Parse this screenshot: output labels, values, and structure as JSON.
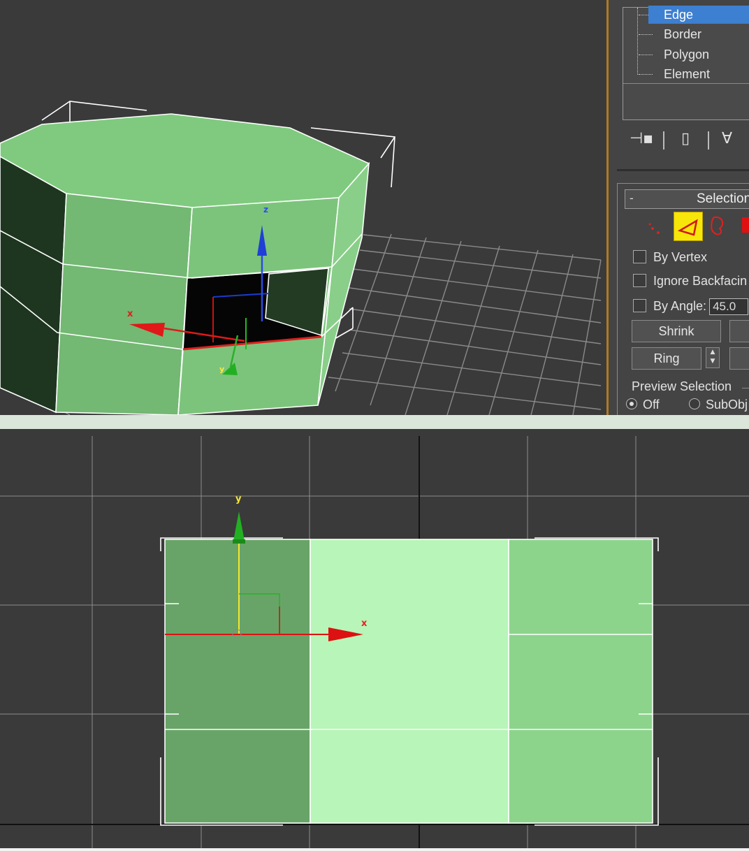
{
  "viewport_perspective": {
    "gizmo_labels": {
      "x": "x",
      "y": "y",
      "z": "z"
    }
  },
  "modifier_stack": {
    "items": [
      {
        "label": "Edge",
        "selected": true
      },
      {
        "label": "Border",
        "selected": false
      },
      {
        "label": "Polygon",
        "selected": false
      },
      {
        "label": "Element",
        "selected": false
      }
    ],
    "tool_icons": [
      "pin-stack-icon",
      "show-end-result-icon",
      "make-unique-icon"
    ]
  },
  "selection_rollout": {
    "collapse_symbol": "-",
    "title": "Selection",
    "subobject_icons": [
      "vertex-icon",
      "edge-icon",
      "border-icon",
      "polygon-icon"
    ],
    "by_vertex_label": "By Vertex",
    "ignore_backfacing_label": "Ignore Backfacin",
    "by_angle_label": "By Angle:",
    "by_angle_value": "45.0",
    "shrink_label": "Shrink",
    "ring_label": "Ring",
    "preview_selection_label": "Preview Selection",
    "preview_off_label": "Off",
    "preview_subobj_label": "SubObj",
    "colors": {
      "active_icon_bg": "#f6e60a",
      "highlight": "#3d7fd0"
    }
  },
  "viewport_ortho": {
    "gizmo_labels": {
      "x": "x",
      "y": "y"
    },
    "colors": {
      "dark_panel": "#68a468",
      "light_panel": "#b8f5b8",
      "mid_panel": "#8cd48c"
    }
  }
}
